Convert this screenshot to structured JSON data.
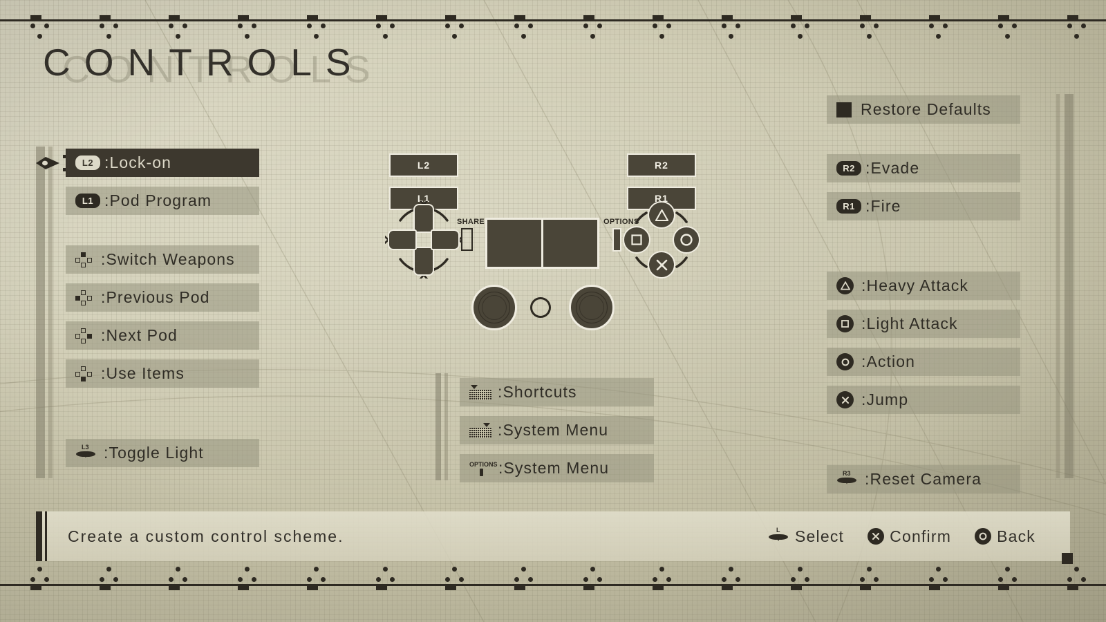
{
  "screen": {
    "title": "CONTROLS",
    "title_ghost": "CONTROLS"
  },
  "left_column": {
    "items": [
      {
        "id": "lock-on",
        "icon": "l2-button-icon",
        "chip": "L2",
        "label": ":Lock-on",
        "selected": true
      },
      {
        "id": "pod-program",
        "icon": "l1-button-icon",
        "chip": "L1",
        "label": ":Pod Program",
        "selected": false
      },
      {
        "id": "switch-weapons",
        "icon": "dpad-up-icon",
        "chip": "",
        "label": ":Switch Weapons",
        "selected": false
      },
      {
        "id": "previous-pod",
        "icon": "dpad-left-icon",
        "chip": "",
        "label": ":Previous Pod",
        "selected": false
      },
      {
        "id": "next-pod",
        "icon": "dpad-right-icon",
        "chip": "",
        "label": ":Next Pod",
        "selected": false
      },
      {
        "id": "use-items",
        "icon": "dpad-down-icon",
        "chip": "",
        "label": ":Use Items",
        "selected": false
      },
      {
        "id": "toggle-light",
        "icon": "l3-stick-press-icon",
        "chip": "L3",
        "label": ":Toggle Light",
        "selected": false
      }
    ]
  },
  "right_column": {
    "items": [
      {
        "id": "restore-defaults",
        "icon": "touchpad-square-icon",
        "chip": "",
        "label": "Restore Defaults"
      },
      {
        "id": "evade",
        "icon": "r2-button-icon",
        "chip": "R2",
        "label": ":Evade"
      },
      {
        "id": "fire",
        "icon": "r1-button-icon",
        "chip": "R1",
        "label": ":Fire"
      },
      {
        "id": "heavy-attack",
        "icon": "triangle-button-icon",
        "chip": "",
        "label": ":Heavy Attack"
      },
      {
        "id": "light-attack",
        "icon": "square-button-icon",
        "chip": "",
        "label": ":Light Attack"
      },
      {
        "id": "action",
        "icon": "circle-button-icon",
        "chip": "",
        "label": ":Action"
      },
      {
        "id": "jump",
        "icon": "cross-button-icon",
        "chip": "",
        "label": ":Jump"
      },
      {
        "id": "reset-camera",
        "icon": "r3-stick-press-icon",
        "chip": "R3",
        "label": ":Reset Camera"
      }
    ]
  },
  "middle_column": {
    "items": [
      {
        "id": "shortcuts",
        "icon": "touchpad-left-icon",
        "label": ":Shortcuts"
      },
      {
        "id": "system-menu-pad",
        "icon": "touchpad-right-icon",
        "label": ":System Menu"
      },
      {
        "id": "system-menu-opts",
        "icon": "options-button-icon",
        "label": ":System Menu"
      }
    ]
  },
  "controller": {
    "shoulders": [
      {
        "id": "l2",
        "label": "L2"
      },
      {
        "id": "l1",
        "label": "L1"
      },
      {
        "id": "r2",
        "label": "R2"
      },
      {
        "id": "r1",
        "label": "R1"
      }
    ],
    "share_label": "SHARE",
    "options_label": "OPTIONS"
  },
  "footer": {
    "description": "Create a custom control scheme.",
    "hints": [
      {
        "id": "select",
        "icon": "left-stick-icon",
        "label": "Select"
      },
      {
        "id": "confirm",
        "icon": "cross-button-icon",
        "label": "Confirm"
      },
      {
        "id": "back",
        "icon": "circle-button-icon",
        "label": "Back"
      }
    ]
  },
  "colors": {
    "background": "#c9c5aa",
    "ink": "#2e2a22",
    "row_bg": "#969a7e",
    "row_selected_bg": "#3d382e",
    "row_selected_text": "#ddd9c8",
    "pad_fill": "#4a4538",
    "pad_outline": "#efece0"
  }
}
